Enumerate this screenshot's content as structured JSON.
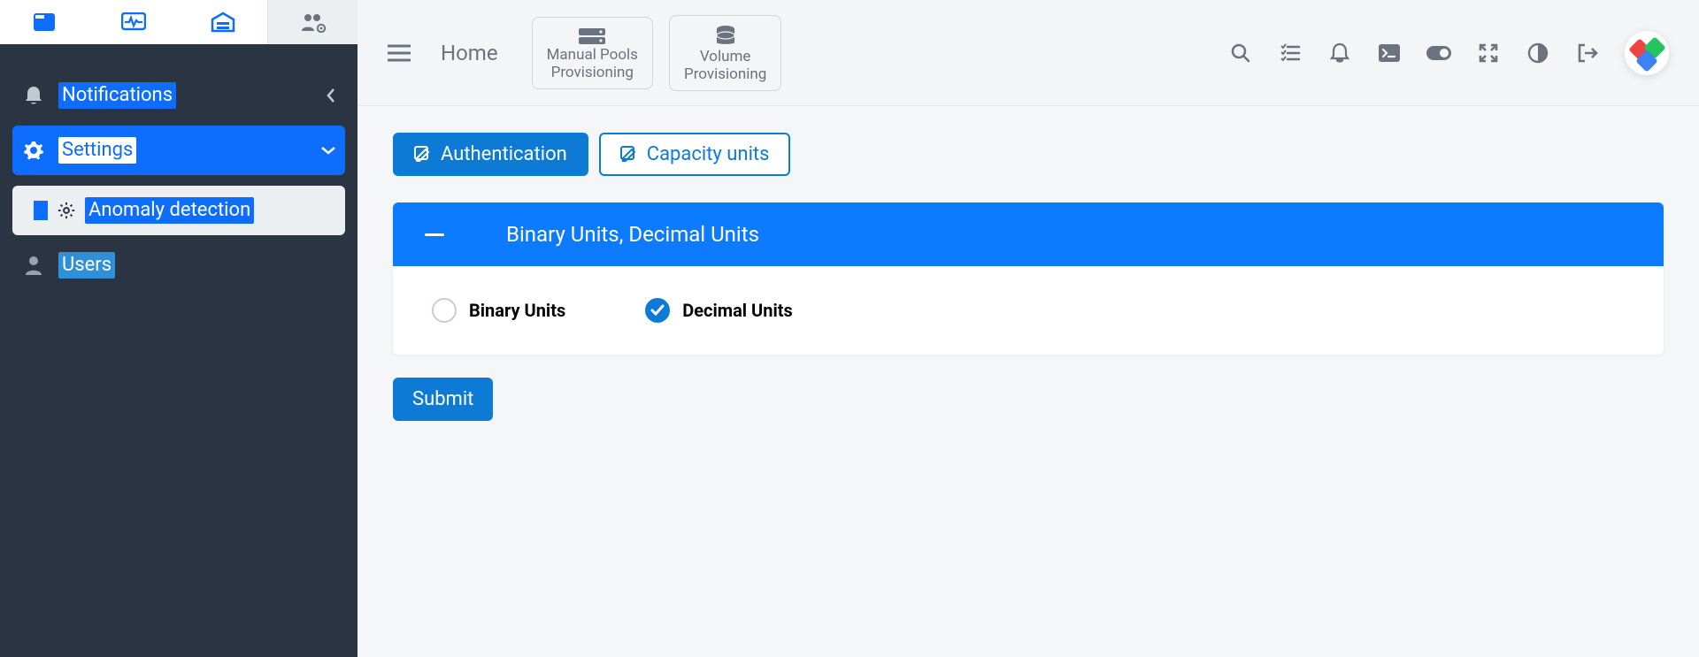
{
  "sidebar": {
    "notifications_label": "Notifications",
    "settings_label": "Settings",
    "anomaly_label": "Anomaly detection",
    "users_label": "Users"
  },
  "topbar": {
    "home_label": "Home",
    "card1_line1": "Manual Pools",
    "card1_line2": "Provisioning",
    "card2_line1": "Volume",
    "card2_line2": "Provisioning"
  },
  "tabs": {
    "auth_label": "Authentication",
    "capacity_label": "Capacity units"
  },
  "panel": {
    "header": "Binary Units, Decimal Units",
    "option_binary": "Binary Units",
    "option_decimal": "Decimal Units"
  },
  "submit_label": "Submit"
}
